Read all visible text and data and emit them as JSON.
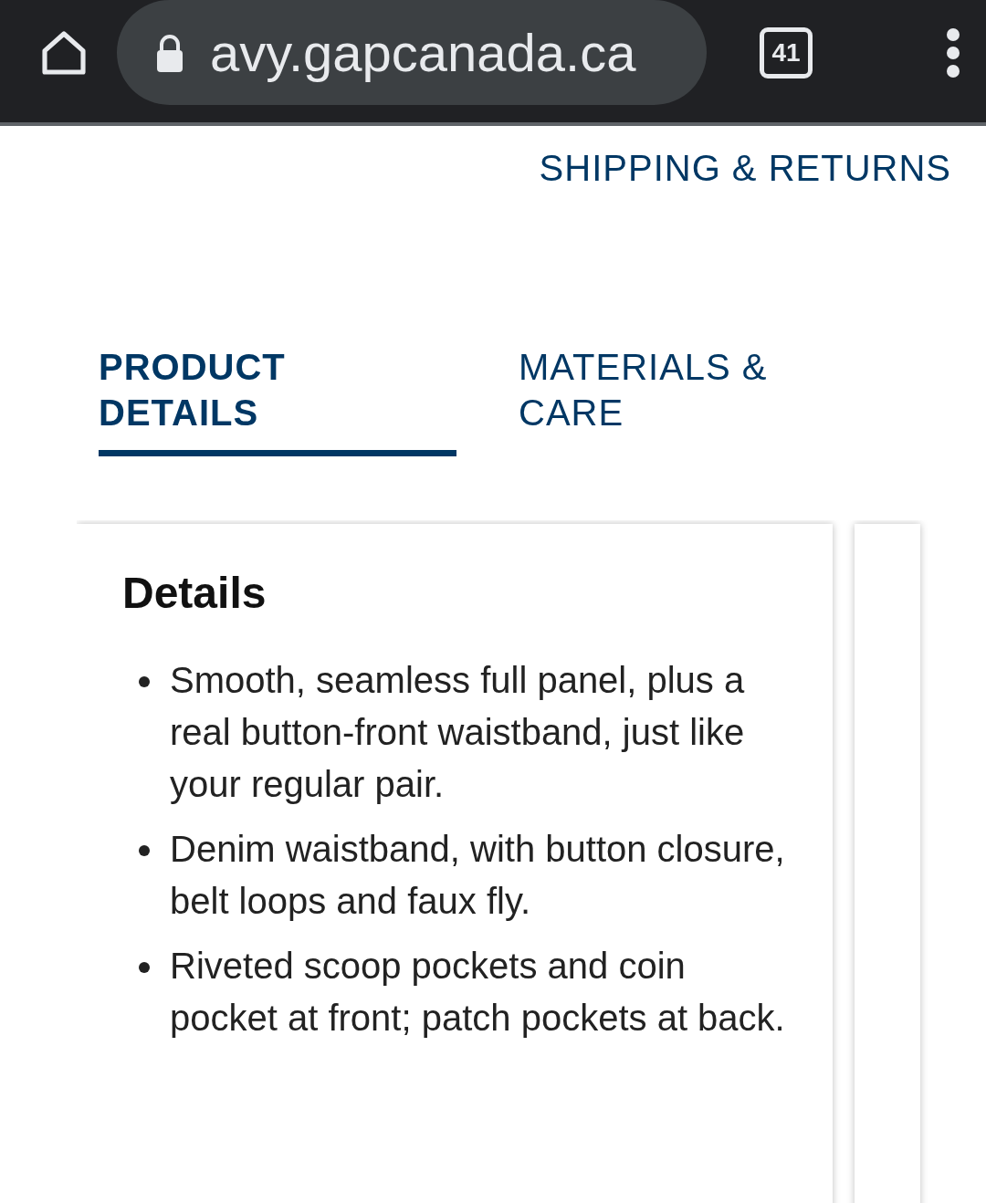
{
  "browser": {
    "url": "avy.gapcanada.ca",
    "tab_count": "41"
  },
  "shipping_link": "SHIPPING & RETURNS",
  "tabs": [
    {
      "label": "PRODUCT DETAILS",
      "selected": true
    },
    {
      "label": "MATERIALS & CARE",
      "selected": false
    }
  ],
  "details_card": {
    "heading": "Details",
    "bullets": [
      "Smooth, seamless full panel, plus a real button-front waistband, just like your regular pair.",
      "Denim waistband, with button closure, belt loops and faux fly.",
      "Riveted scoop pockets and coin pocket at front; patch pockets at back."
    ]
  }
}
